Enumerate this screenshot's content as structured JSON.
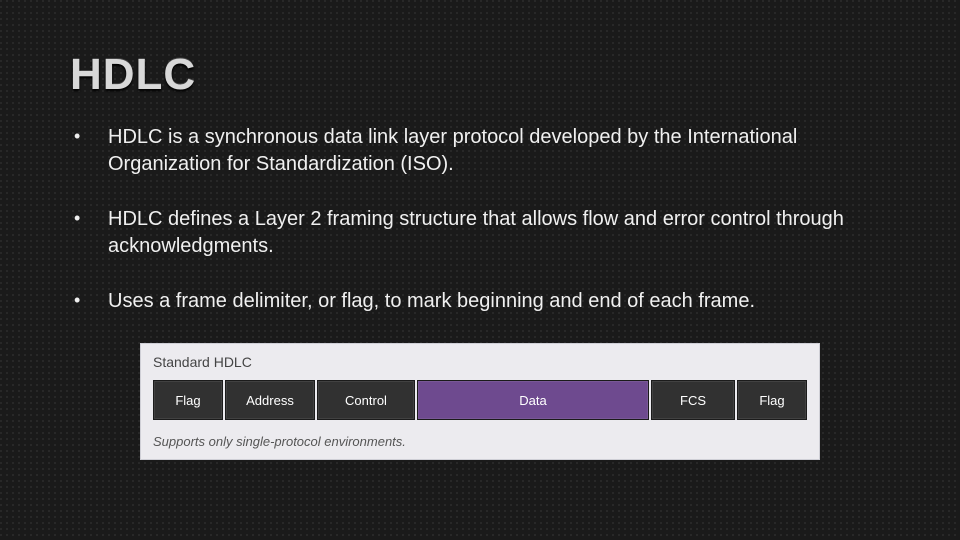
{
  "title": "HDLC",
  "bullets": [
    "HDLC is a synchronous data link layer protocol developed by the International Organization for Standardization (ISO).",
    "HDLC defines a Layer 2 framing structure that allows flow and error control through acknowledgments.",
    "Uses a frame delimiter, or flag, to mark beginning and end of each frame."
  ],
  "figure": {
    "title": "Standard HDLC",
    "fields": [
      "Flag",
      "Address",
      "Control",
      "Data",
      "FCS",
      "Flag"
    ],
    "caption": "Supports only single-protocol environments."
  }
}
